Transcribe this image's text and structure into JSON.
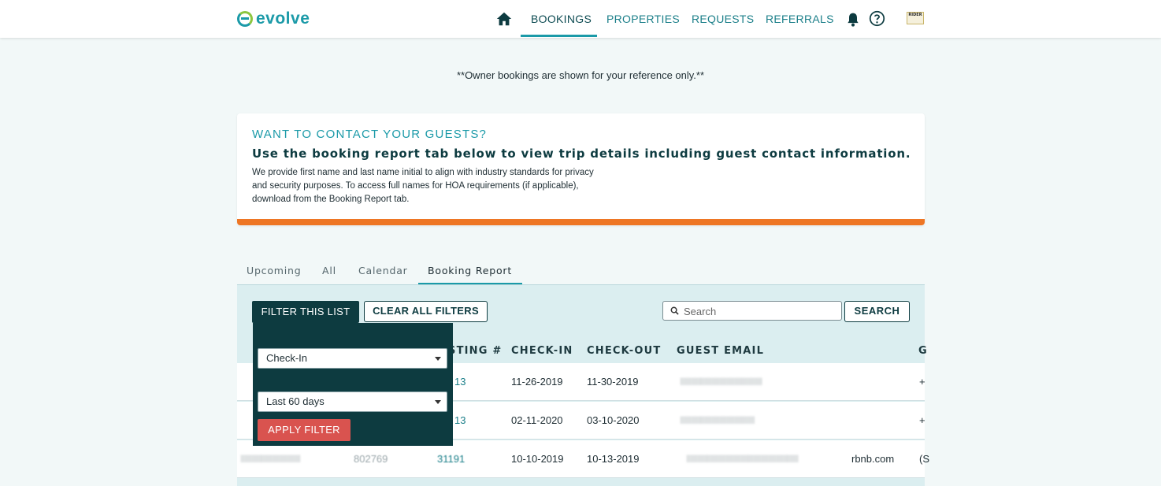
{
  "brand": {
    "name": "evolve"
  },
  "nav": {
    "items": [
      {
        "label": "BOOKINGS",
        "active": true
      },
      {
        "label": "PROPERTIES",
        "active": false
      },
      {
        "label": "REQUESTS",
        "active": false
      },
      {
        "label": "REFERRALS",
        "active": false
      }
    ],
    "icons": [
      "home-icon",
      "bell-icon",
      "help-icon"
    ],
    "avatar_text": "RIDER"
  },
  "notice": "**Owner bookings are shown for your reference only.**",
  "contact_card": {
    "title": "WANT TO CONTACT YOUR GUESTS?",
    "headline": "Use the booking report tab below to view trip details including guest contact information.",
    "body": "We provide first name and last name initial to align with industry standards for privacy and security purposes. To access full names for HOA requirements (if applicable), download from the Booking Report tab.",
    "accent_color": "#ee7624"
  },
  "tabs": [
    {
      "label": "Upcoming",
      "active": false
    },
    {
      "label": "All",
      "active": false
    },
    {
      "label": "Calendar",
      "active": false
    },
    {
      "label": "Booking Report",
      "active": true
    }
  ],
  "toolbar": {
    "filter_label": "FILTER THIS LIST",
    "clear_label": "CLEAR ALL FILTERS",
    "search_placeholder": "Search",
    "search_label": "SEARCH"
  },
  "filter_popup": {
    "field_value": "Check-In",
    "range_value": "Last 60 days",
    "apply_label": "APPLY FILTER"
  },
  "table": {
    "headers": [
      "STING #",
      "CHECK-IN",
      "CHECK-OUT",
      "GUEST EMAIL",
      "G"
    ],
    "rows": [
      {
        "listing_tail": "13",
        "check_in": "11-26-2019",
        "check_out": "11-30-2019",
        "email_suffix": "",
        "phone_prefix": "+"
      },
      {
        "listing_tail": "13",
        "check_in": "02-11-2020",
        "check_out": "03-10-2020",
        "email_suffix": "",
        "phone_prefix": "+"
      },
      {
        "listing_tail": "31191",
        "booking_id": "802769",
        "check_in": "10-10-2019",
        "check_out": "10-13-2019",
        "email_suffix": "rbnb.com",
        "phone_prefix": "(S"
      }
    ]
  },
  "colors": {
    "primary_dark": "#0d3b40",
    "accent_teal": "#1b9aa8",
    "apply_red": "#d9534f",
    "panel_bg": "#dbeef0"
  }
}
